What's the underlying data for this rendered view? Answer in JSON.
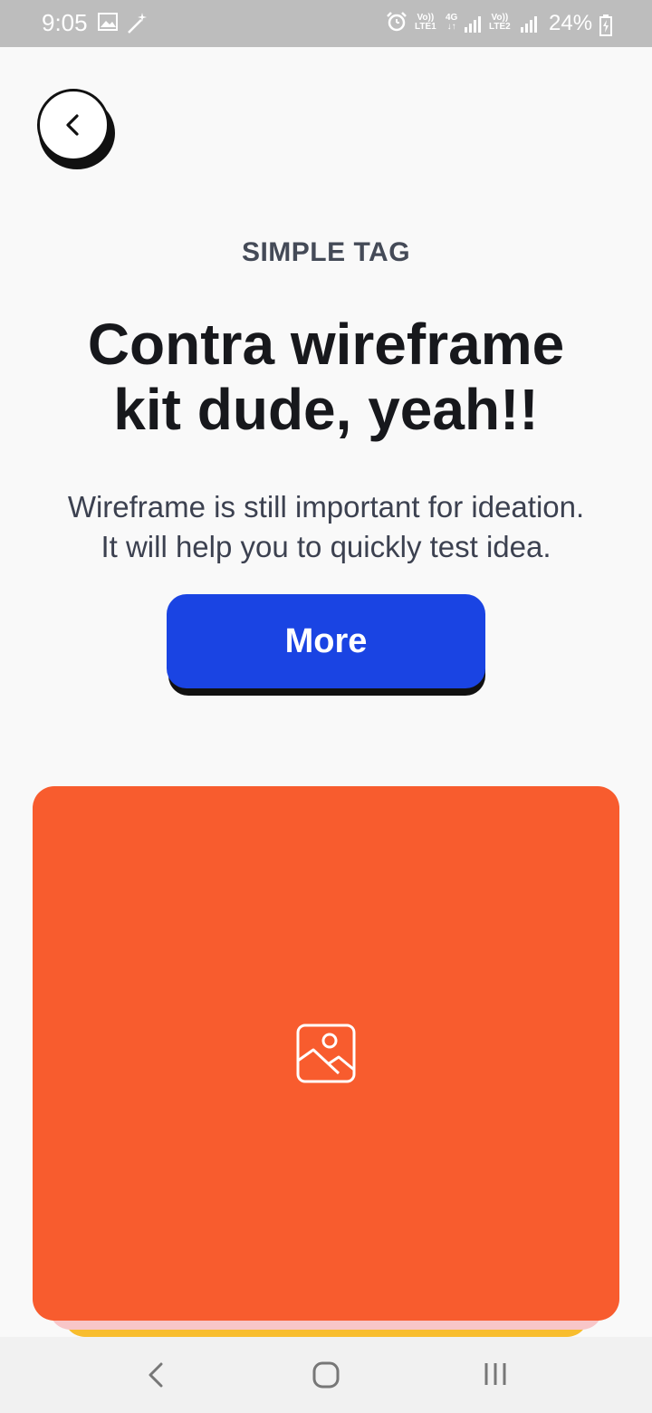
{
  "status_bar": {
    "time": "9:05",
    "sim1_label_top": "Vo))",
    "sim1_label_bottom": "LTE1",
    "network_type": "4G",
    "sim2_label_top": "Vo))",
    "sim2_label_bottom": "LTE2",
    "battery_percent": "24%",
    "icons": [
      "gallery-icon",
      "magic-wand-icon",
      "alarm-icon",
      "signal-icon",
      "battery-charging-icon"
    ]
  },
  "header": {
    "back_icon": "chevron-left-icon"
  },
  "content": {
    "tag": "SIMPLE TAG",
    "headline_line1": "Contra wireframe",
    "headline_line2": "kit dude, yeah!!",
    "body_line1": "Wireframe is still important for ideation.",
    "body_line2": "It will help you to quickly test idea.",
    "cta_label": "More"
  },
  "card": {
    "icon": "image-placeholder-icon",
    "colors": {
      "front": "#f85c2e",
      "middle": "#f8c6c8",
      "back": "#f8bd2e"
    }
  },
  "colors": {
    "accent": "#1a44e3",
    "text_dark": "#17181c",
    "text_muted": "#3c4150"
  },
  "nav_bar": {
    "icons": [
      "nav-back-icon",
      "nav-home-icon",
      "nav-recents-icon"
    ]
  }
}
